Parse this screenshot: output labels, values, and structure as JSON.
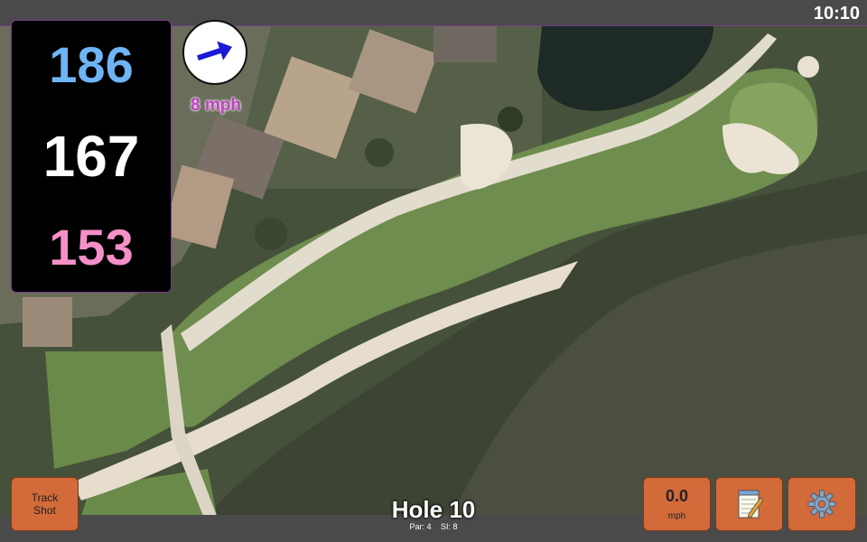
{
  "clock": "10:10",
  "distances": {
    "back": "186",
    "middle": "167",
    "front": "153"
  },
  "wind": {
    "label": "8 mph",
    "direction_icon": "arrow-icon"
  },
  "buttons": {
    "track_shot_line1": "Track",
    "track_shot_line2": "Shot",
    "wind_speed_value": "0.0",
    "wind_speed_unit": "mph",
    "notes_icon": "notepad-icon",
    "settings_icon": "gear-icon"
  },
  "hole": {
    "title": "Hole 10",
    "par": "Par: 4",
    "si": "SI: 8"
  },
  "colors": {
    "back": "#6fb4f5",
    "middle": "#ffffff",
    "front": "#f58fc8",
    "button": "#d26a3a",
    "wind_text": "#c040c0",
    "arrow": "#1a1ad8"
  }
}
